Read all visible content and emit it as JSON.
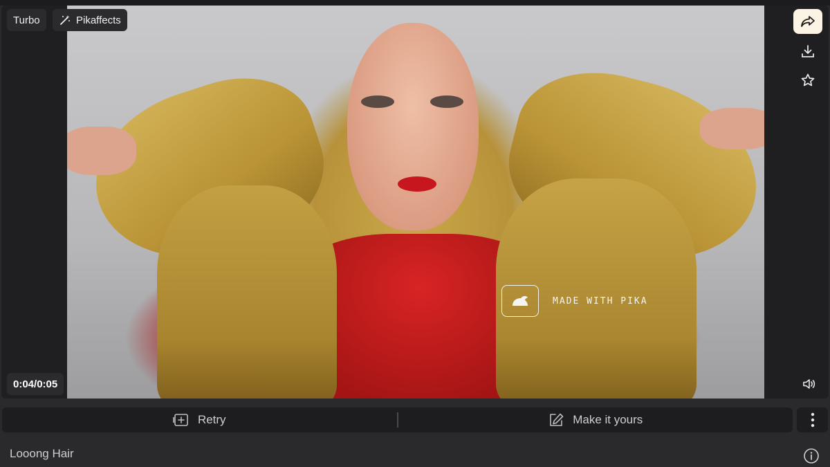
{
  "badges": {
    "turbo": "Turbo",
    "pikaffects": "Pikaffects"
  },
  "player": {
    "time": "0:04/0:05"
  },
  "watermark": {
    "text": "MADE WITH PIKA"
  },
  "actions": {
    "retry": "Retry",
    "make_it_yours": "Make it yours"
  },
  "prompt": {
    "text": "Looong Hair"
  },
  "icons": {
    "turbo": "",
    "pikaffects": "magic-wand-icon",
    "share": "share-arrow-icon",
    "download": "download-icon",
    "favorite": "star-icon",
    "volume": "speaker-icon",
    "retry": "retry-icon",
    "edit": "edit-icon",
    "more": "more-vertical-icon",
    "info": "info-icon"
  },
  "colors": {
    "share_bg": "#fbf3e4",
    "bar_bg": "#1d1d1f",
    "page_bg": "#2a2a2c"
  }
}
